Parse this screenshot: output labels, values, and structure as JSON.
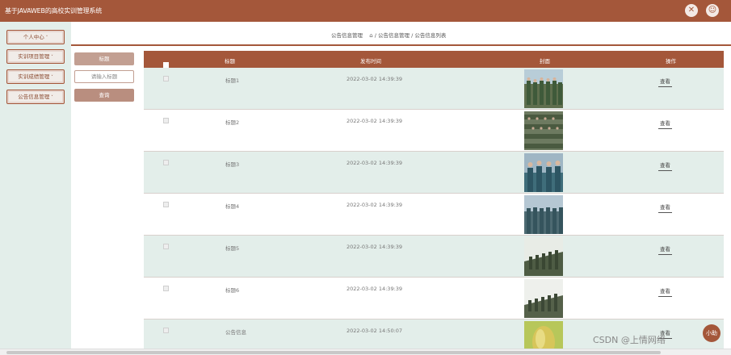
{
  "app": {
    "title": "基于JAVAWEB的高校实训管理系统"
  },
  "topbar": {
    "close_icon": "close-circle-icon",
    "user_icon": "user-circle-icon"
  },
  "sidebar": {
    "items": [
      {
        "label": "个人中心"
      },
      {
        "label": "实训项目管理"
      },
      {
        "label": "实训成绩管理"
      },
      {
        "label": "公告信息管理"
      }
    ]
  },
  "breadcrumb": {
    "current_section": "公告信息管理",
    "path": "/ 公告信息管理 / 公告信息列表"
  },
  "search": {
    "label": "标题",
    "placeholder": "请输入标题",
    "query_label": "查询"
  },
  "table": {
    "headers": {
      "title": "标题",
      "time": "发布时间",
      "cover": "封面",
      "action": "操作"
    },
    "rows": [
      {
        "title": "标题1",
        "time": "2022-03-02 14:39:39",
        "action": "查看"
      },
      {
        "title": "标题2",
        "time": "2022-03-02 14:39:39",
        "action": "查看"
      },
      {
        "title": "标题3",
        "time": "2022-03-02 14:39:39",
        "action": "查看"
      },
      {
        "title": "标题4",
        "time": "2022-03-02 14:39:39",
        "action": "查看"
      },
      {
        "title": "标题5",
        "time": "2022-03-02 14:39:39",
        "action": "查看"
      },
      {
        "title": "标题6",
        "time": "2022-03-02 14:39:39",
        "action": "查看"
      },
      {
        "title": "公告信息",
        "time": "2022-03-02 14:50:07",
        "action": "查看"
      }
    ]
  },
  "watermark": "CSDN @上情网络",
  "fab": {
    "label": "小助"
  },
  "colors": {
    "accent": "#a4573a",
    "row_alt": "#e3eeea"
  }
}
